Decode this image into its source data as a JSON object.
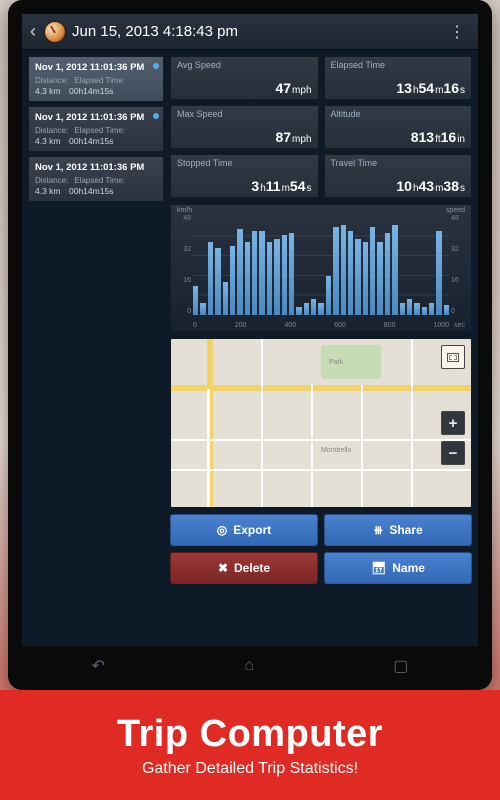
{
  "header": {
    "title": "Jun 15, 2013 4:18:43 pm"
  },
  "trips": [
    {
      "timestamp": "Nov 1, 2012 11:01:36 PM",
      "dist_label": "Distance:",
      "time_label": "Elapsed Time:",
      "distance": "4.3 km",
      "elapsed": "00h14m15s",
      "selected": true
    },
    {
      "timestamp": "Nov 1, 2012 11:01:36 PM",
      "dist_label": "Distance:",
      "time_label": "Elapsed Time:",
      "distance": "4.3 km",
      "elapsed": "00h14m15s",
      "selected": false
    },
    {
      "timestamp": "Nov 1, 2012 11:01:36 PM",
      "dist_label": "Distance:",
      "time_label": "Elapsed Time:",
      "distance": "4.3 km",
      "elapsed": "00h14m15s",
      "selected": false
    }
  ],
  "stats": {
    "avg_speed": {
      "label": "Avg Speed",
      "value": "47",
      "unit": "mph"
    },
    "elapsed": {
      "label": "Elapsed Time",
      "h": "13",
      "m": "54",
      "s": "16"
    },
    "max_speed": {
      "label": "Max Speed",
      "value": "87",
      "unit": "mph"
    },
    "altitude": {
      "label": "Altitude",
      "ft": "813",
      "in": "16"
    },
    "stopped": {
      "label": "Stopped Time",
      "h": "3",
      "m": "11",
      "s": "54"
    },
    "travel": {
      "label": "Travel Time",
      "h": "10",
      "m": "43",
      "s": "38"
    }
  },
  "actions": {
    "export": "Export",
    "share": "Share",
    "delete": "Delete",
    "name": "Name"
  },
  "promo": {
    "title": "Trip Computer",
    "subtitle": "Gather Detailed Trip Statistics!"
  },
  "chart_data": {
    "type": "bar",
    "title": "",
    "xlabel": "sec",
    "ylabel_left": "km/h",
    "ylabel_right": "speed",
    "xticks": [
      0,
      200,
      400,
      600,
      800,
      1000
    ],
    "yticks": [
      0,
      16,
      32,
      48
    ],
    "ylim": [
      0,
      48
    ],
    "values": [
      14,
      6,
      36,
      33,
      16,
      34,
      42,
      36,
      41,
      41,
      36,
      37,
      39,
      40,
      4,
      6,
      8,
      6,
      19,
      43,
      44,
      41,
      37,
      36,
      43,
      36,
      40,
      44,
      6,
      8,
      6,
      4,
      6,
      41,
      5
    ]
  }
}
